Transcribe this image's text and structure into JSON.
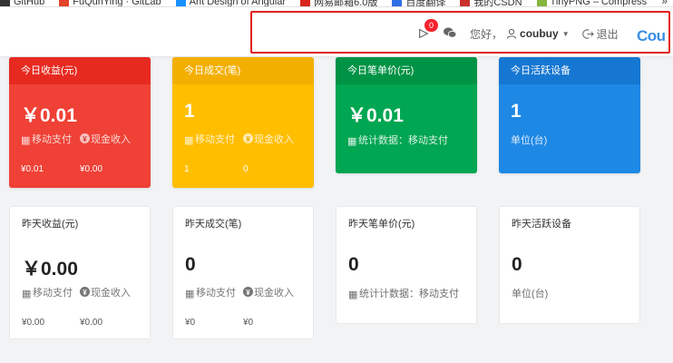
{
  "bookmarks": {
    "items": [
      {
        "label": "GitHub",
        "color": "#333333"
      },
      {
        "label": "FuQunYing · GitLab",
        "color": "#e24329"
      },
      {
        "label": "Ant Design of Angular",
        "color": "#1890ff"
      },
      {
        "label": "网易邮箱6.0版",
        "color": "#d9251c"
      },
      {
        "label": "百度翻译",
        "color": "#2f6fe6"
      },
      {
        "label": "我的CSDN",
        "color": "#c9302c"
      },
      {
        "label": "TinyPNG – Compress",
        "color": "#84b53d"
      }
    ],
    "more": "»"
  },
  "header": {
    "badge_count": "0",
    "greeting": "您好，",
    "username": "coubuy",
    "logout": "退出",
    "logo": "Cou"
  },
  "today": [
    {
      "title": "今日收益(元)",
      "value": "￥0.01",
      "color": "red",
      "sub1_label": "移动支付",
      "sub1_value": "¥0.01",
      "sub2_label": "现金收入",
      "sub2_value": "¥0.00"
    },
    {
      "title": "今日成交(笔)",
      "value": "1",
      "color": "yellow",
      "sub1_label": "移动支付",
      "sub1_value": "1",
      "sub2_label": "现金收入",
      "sub2_value": "0"
    },
    {
      "title": "今日笔单价(元)",
      "value": "￥0.01",
      "color": "green",
      "note": "统计数据：移动支付"
    },
    {
      "title": "今日活跃设备",
      "value": "1",
      "color": "blue",
      "note": "单位(台)"
    }
  ],
  "yesterday": [
    {
      "title": "昨天收益(元)",
      "value": "￥0.00",
      "sub1_label": "移动支付",
      "sub1_value": "¥0.00",
      "sub2_label": "现金收入",
      "sub2_value": "¥0.00"
    },
    {
      "title": "昨天成交(笔)",
      "value": "0",
      "sub1_label": "移动支付",
      "sub1_value": "¥0",
      "sub2_label": "现金收入",
      "sub2_value": "¥0"
    },
    {
      "title": "昨天笔单价(元)",
      "value": "0",
      "note": "统计计数据：移动支付"
    },
    {
      "title": "昨天活跃设备",
      "value": "0",
      "note": "单位(台)"
    }
  ],
  "colors": {
    "red": "#ef4136",
    "yellow": "#ffbe00",
    "green": "#00a651",
    "blue": "#1e88e5",
    "highlight": "#e02020"
  }
}
